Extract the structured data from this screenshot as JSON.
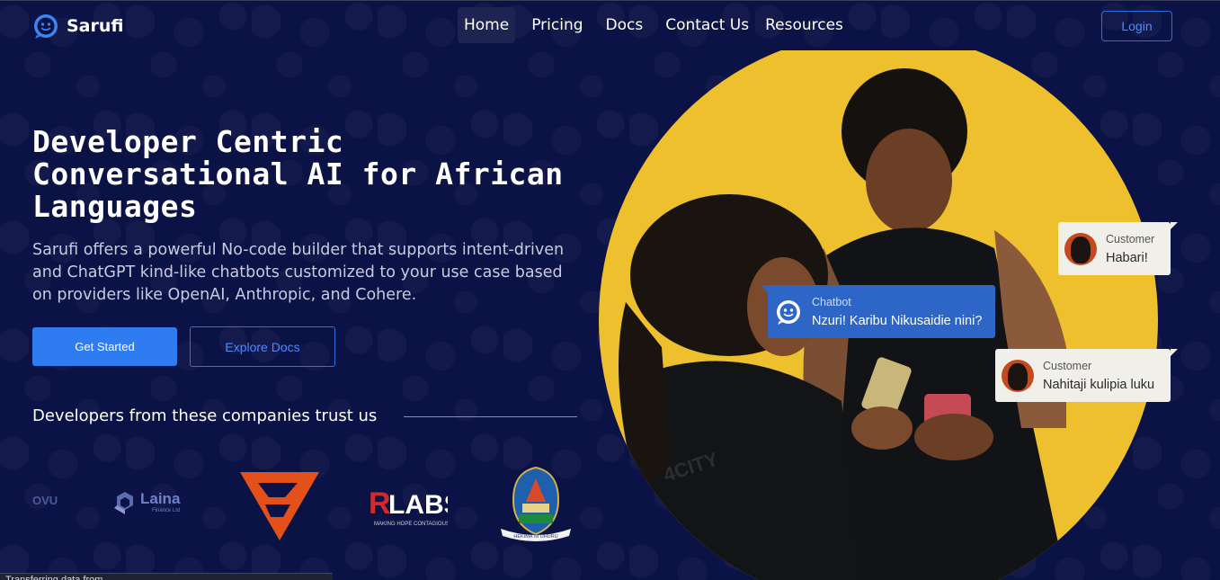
{
  "nav": {
    "brand": "Sarufi",
    "links": [
      {
        "label": "Home"
      },
      {
        "label": "Pricing"
      },
      {
        "label": "Docs"
      },
      {
        "label": "Contact Us"
      },
      {
        "label": "Resources"
      }
    ],
    "login_label": "Login"
  },
  "hero": {
    "headline_line1": "Developer Centric",
    "headline_line2": "Conversational AI for African",
    "headline_line3": "Languages",
    "subtext": "Sarufi offers a powerful No-code builder that supports intent-driven and ChatGPT kind-like chatbots customized to your use case based on providers like OpenAI, Anthropic, and Cohere.",
    "primary_cta": "Get Started",
    "secondary_cta": "Explore Docs"
  },
  "trust": {
    "title": "Developers from these companies trust us",
    "logos": {
      "ovu": "OVU",
      "laina": "Laina",
      "laina_sub": "Finance Ltd",
      "rlabs": "RLABS",
      "rlabs_sub": "MAKING HOPE CONTAGIOUS",
      "udsm_motto": "HEKIMA NI UHURU"
    }
  },
  "chat": {
    "customer1": {
      "who": "Customer",
      "msg": "Habari!"
    },
    "bot": {
      "who": "Chatbot",
      "msg": "Nzuri! Karibu Nikusaidie nini?"
    },
    "customer2": {
      "who": "Customer",
      "msg": "Nahitaji kulipia luku"
    }
  },
  "status_bar": {
    "text": "Transferring data from ..."
  },
  "colors": {
    "background": "#0b1245",
    "accent": "#2f7bf0",
    "hero_circle": "#efc02e",
    "bot_bubble": "#2d66c7"
  }
}
